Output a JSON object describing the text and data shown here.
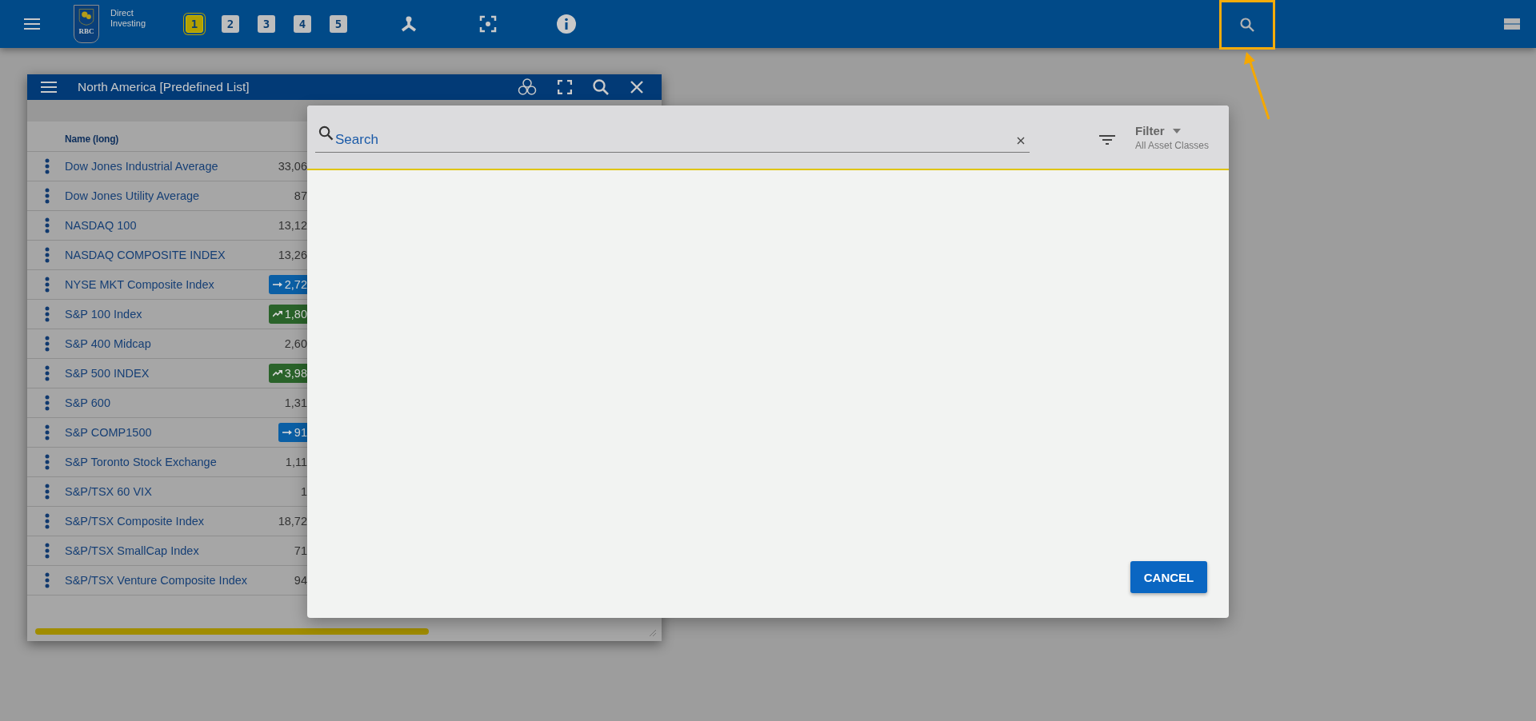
{
  "top_bar": {
    "brand": "Direct Investing",
    "logo_text": "RBC",
    "workspaces": [
      {
        "label": "1",
        "selected": true
      },
      {
        "label": "2",
        "selected": false
      },
      {
        "label": "3",
        "selected": false
      },
      {
        "label": "4",
        "selected": false
      },
      {
        "label": "5",
        "selected": false
      }
    ],
    "search_highlighted": true
  },
  "panel": {
    "title": "North America [Predefined List]",
    "column_header": "Name (long)",
    "rows": [
      {
        "name": "Dow Jones Industrial Average",
        "value": "33,06",
        "kind": "plain"
      },
      {
        "name": "Dow Jones Utility Average",
        "value": "87",
        "kind": "plain"
      },
      {
        "name": "NASDAQ 100",
        "value": "13,12",
        "kind": "plain"
      },
      {
        "name": "NASDAQ COMPOSITE INDEX",
        "value": "13,26",
        "kind": "plain"
      },
      {
        "name": "NYSE MKT Composite Index",
        "value": "2,72",
        "kind": "flat"
      },
      {
        "name": "S&P 100 Index",
        "value": "1,80",
        "kind": "up"
      },
      {
        "name": "S&P 400 Midcap",
        "value": "2,60",
        "kind": "plain"
      },
      {
        "name": "S&P 500 INDEX",
        "value": "3,98",
        "kind": "up"
      },
      {
        "name": "S&P 600",
        "value": "1,31",
        "kind": "plain"
      },
      {
        "name": "S&P COMP1500",
        "value": "91",
        "kind": "flat"
      },
      {
        "name": "S&P Toronto Stock Exchange",
        "value": "1,11",
        "kind": "plain"
      },
      {
        "name": "S&P/TSX 60 VIX",
        "value": "1",
        "kind": "plain"
      },
      {
        "name": "S&P/TSX Composite Index",
        "value": "18,72",
        "kind": "plain"
      },
      {
        "name": "S&P/TSX SmallCap Index",
        "value": "71",
        "kind": "plain"
      },
      {
        "name": "S&P/TSX Venture Composite Index",
        "value": "94",
        "kind": "plain"
      }
    ]
  },
  "dialog": {
    "search": {
      "placeholder": "Search"
    },
    "filter": {
      "label": "Filter",
      "value": "All Asset Classes"
    },
    "buttons": [
      "CANCEL"
    ]
  }
}
